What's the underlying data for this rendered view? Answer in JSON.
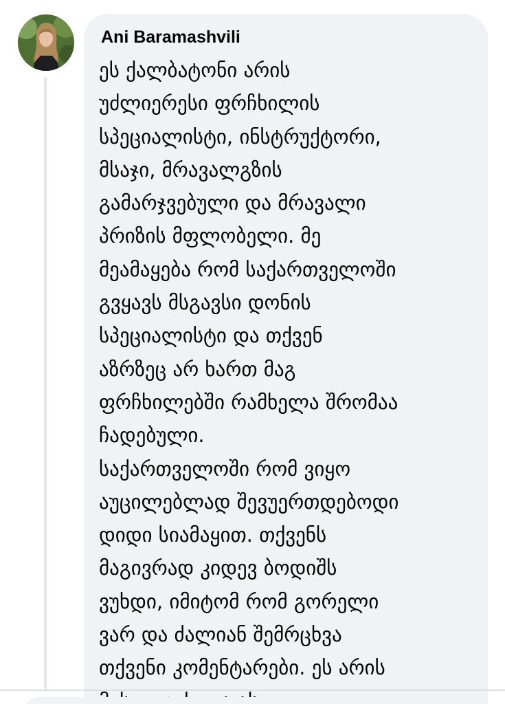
{
  "comment": {
    "author": "Ani Baramashvili",
    "lines": [
      "ეს ქალბატონი არის",
      "უძლიერესი ფრჩხილის",
      "სპეციალისტი, ინსტრუქტორი,",
      "მსაჯი, მრავალგზის",
      "გამარჯვებული და მრავალი",
      "პრიზის მფლობელი. მე",
      "მეამაყება რომ საქართველოში",
      "გვყავს მსგავსი დონის",
      "სპეციალისტი და თქვენ",
      "აზრზეც არ ხართ მაგ",
      "ფრჩხილებში რამხელა შრომაა",
      "ჩადებული.",
      "საქართველოში რომ ვიყო",
      "აუცილებლად შევუერთდებოდი",
      "დიდი სიამაყით. თქვენს",
      "მაგივრად კიდევ ბოდიშს",
      "ვუხდი, იმიტომ რომ გორელი",
      "ვარ და ძალიან შემრცხვა",
      "თქვენი კომენტარები. ეს არის",
      "მისი ლუქი და ასე"
    ]
  },
  "colors": {
    "bubble": "#f0f2f5",
    "text": "#050505",
    "thread_line": "#e4e6eb"
  }
}
